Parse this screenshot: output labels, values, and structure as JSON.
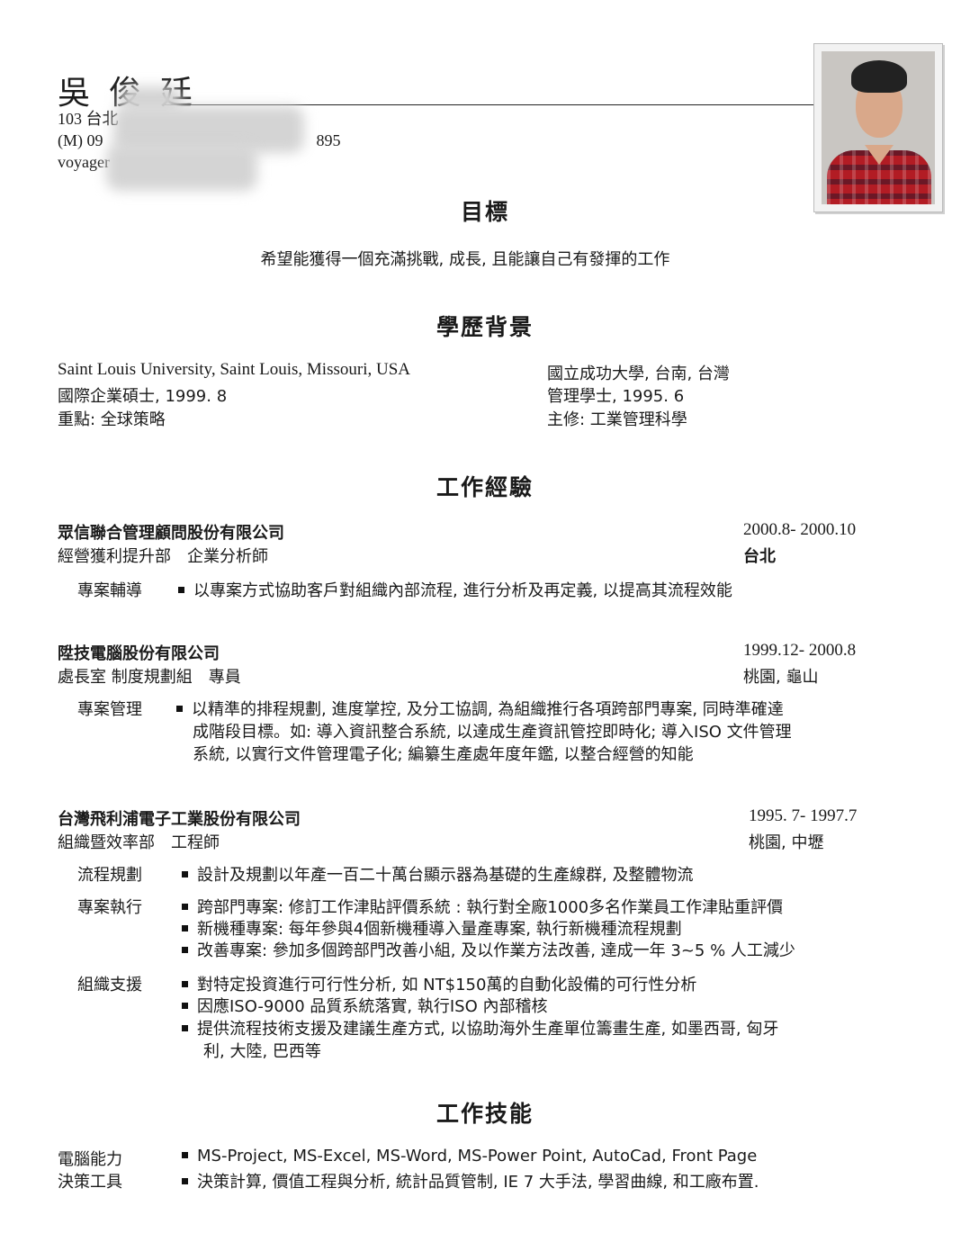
{
  "header": {
    "name": "吳 俊 廷",
    "address": "103 台北",
    "phone_prefix": "(M) 09",
    "phone_suffix": "895",
    "email_prefix": "voyager"
  },
  "objective": {
    "title": "目標",
    "text": "希望能獲得一個充滿挑戰, 成長, 且能讓自己有發揮的工作"
  },
  "education": {
    "title": "學歷背景",
    "left": [
      "Saint Louis University, Saint Louis, Missouri, USA",
      "國際企業碩士, 1999. 8",
      "重點: 全球策略"
    ],
    "right": [
      "國立成功大學, 台南, 台灣",
      "管理學士, 1995. 6",
      "主修: 工業管理科學"
    ]
  },
  "experience": {
    "title": "工作經驗",
    "jobs": [
      {
        "company": "眾信聯合管理顧問股份有限公司",
        "dates": "2000.8- 2000.10",
        "dept": "經營獲利提升部　企業分析師",
        "location": "台北",
        "groups": [
          {
            "label": "專案輔導",
            "lines": [
              "以專案方式協助客戶對組織內部流程, 進行分析及再定義, 以提高其流程效能"
            ]
          }
        ]
      },
      {
        "company": "陞技電腦股份有限公司",
        "dates": "1999.12- 2000.8",
        "dept": "處長室 制度規劃組　專員",
        "location": "桃園, 龜山",
        "groups": [
          {
            "label": "專案管理",
            "lines": [
              "以精準的排程規劃, 進度掌控, 及分工協調, 為組織推行各項跨部門專案, 同時準確達",
              "成階段目標。如: 導入資訊整合系統, 以達成生產資訊管控即時化; 導入ISO 文件管理",
              "系統, 以實行文件管理電子化; 編纂生產處年度年鑑, 以整合經營的知能"
            ]
          }
        ]
      },
      {
        "company": "台灣飛利浦電子工業股份有限公司",
        "dates": "1995. 7- 1997.7",
        "dept": "組織暨效率部　工程師",
        "location": "桃園, 中壢",
        "groups": [
          {
            "label": "流程規劃",
            "lines": [
              "設計及規劃以年產一百二十萬台顯示器為基礎的生產線群, 及整體物流"
            ]
          },
          {
            "label": "專案執行",
            "lines": [
              "跨部門專案: 修訂工作津貼評價系統 : 執行對全廠1000多名作業員工作津貼重評價",
              "新機種專案: 每年參與4個新機種導入量產專案, 執行新機種流程規劃",
              "改善專案: 參加多個跨部門改善小組, 及以作業方法改善, 達成一年 3~5 % 人工減少"
            ]
          },
          {
            "label": "組織支援",
            "lines": [
              "對特定投資進行可行性分析, 如 NT$150萬的自動化設備的可行性分析",
              "因應ISO-9000 品質系統落實, 執行ISO 內部稽核",
              "提供流程技術支援及建議生產方式, 以協助海外生產單位籌畫生產, 如墨西哥, 匈牙",
              "利, 大陸, 巴西等"
            ]
          }
        ]
      }
    ]
  },
  "skills": {
    "title": "工作技能",
    "items": [
      {
        "label": "電腦能力",
        "text": "MS-Project, MS-Excel, MS-Word, MS-Power Point, AutoCad, Front Page"
      },
      {
        "label": "決策工具",
        "text": "決策計算, 價值工程與分析, 統計品質管制, IE 7 大手法, 學習曲線, 和工廠布置."
      }
    ]
  }
}
